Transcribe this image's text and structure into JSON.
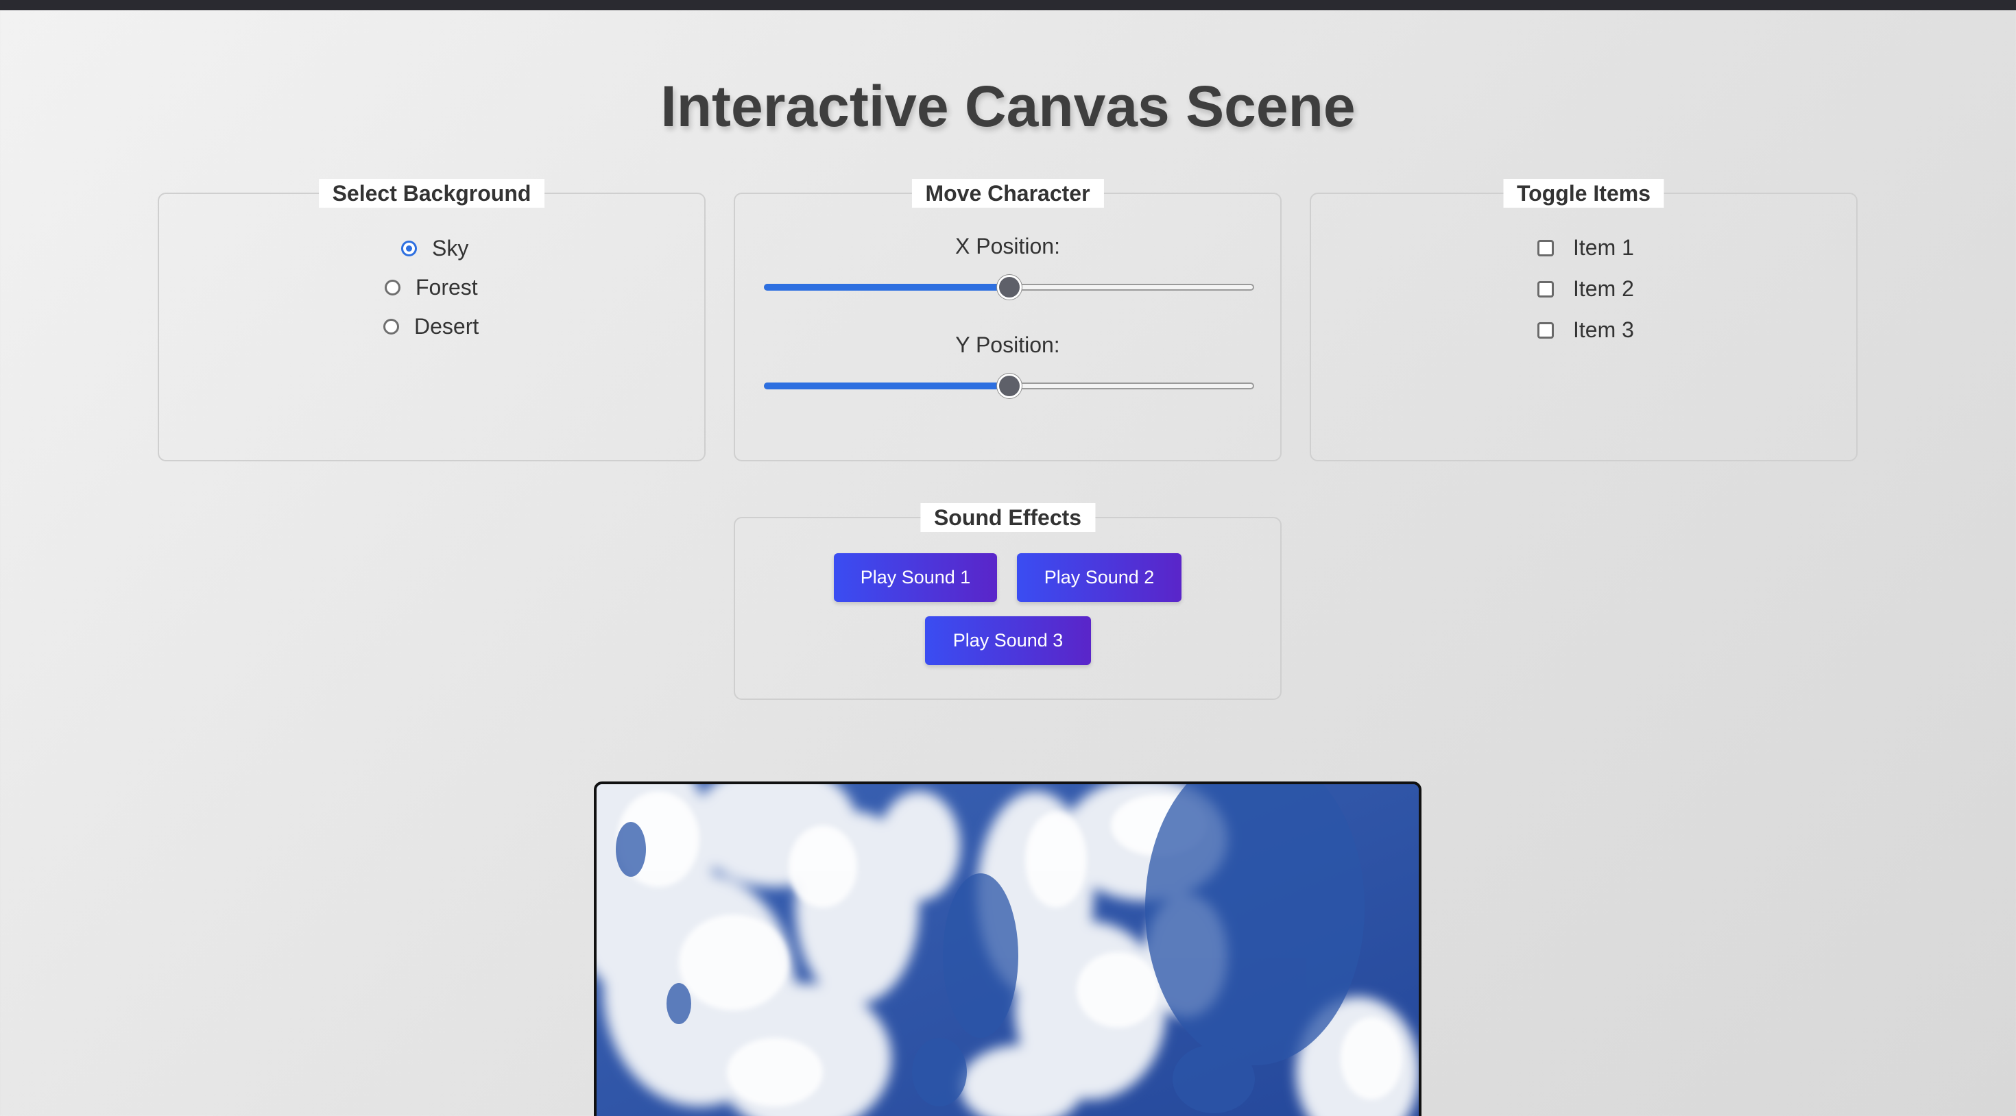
{
  "page": {
    "title": "Interactive Canvas Scene"
  },
  "background_panel": {
    "legend": "Select Background",
    "options": [
      {
        "label": "Sky",
        "checked": true
      },
      {
        "label": "Forest",
        "checked": false
      },
      {
        "label": "Desert",
        "checked": false
      }
    ]
  },
  "move_panel": {
    "legend": "Move Character",
    "x_label": "X Position:",
    "y_label": "Y Position:",
    "x_value_fraction": 0.5,
    "y_value_fraction": 0.5
  },
  "items_panel": {
    "legend": "Toggle Items",
    "items": [
      {
        "label": "Item 1",
        "checked": false
      },
      {
        "label": "Item 2",
        "checked": false
      },
      {
        "label": "Item 3",
        "checked": false
      }
    ]
  },
  "sound_panel": {
    "legend": "Sound Effects",
    "buttons": [
      "Play Sound 1",
      "Play Sound 2",
      "Play Sound 3"
    ]
  },
  "scene": {
    "background": "sky"
  },
  "colors": {
    "accent": "#2d6fe0",
    "button_start": "#3a4df2",
    "button_end": "#5a25c9",
    "sky_blue": "#2f56a8"
  }
}
